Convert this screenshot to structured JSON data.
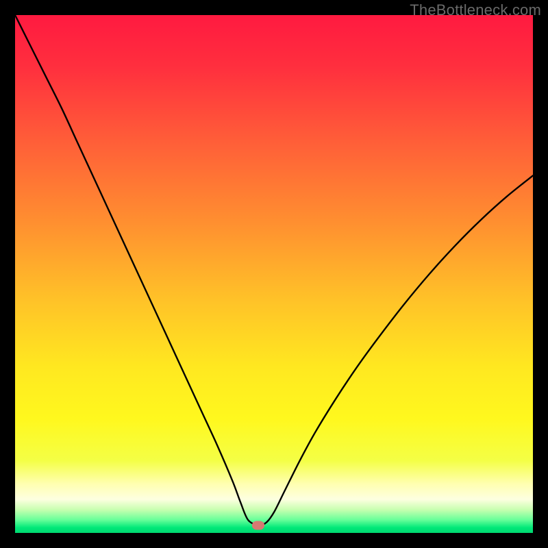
{
  "watermark": {
    "text": "TheBottleneck.com"
  },
  "gradient": {
    "stops": [
      {
        "offset": 0.0,
        "color": "#ff1a40"
      },
      {
        "offset": 0.1,
        "color": "#ff2f3e"
      },
      {
        "offset": 0.25,
        "color": "#ff6038"
      },
      {
        "offset": 0.4,
        "color": "#ff8f30"
      },
      {
        "offset": 0.55,
        "color": "#ffc228"
      },
      {
        "offset": 0.68,
        "color": "#ffe820"
      },
      {
        "offset": 0.78,
        "color": "#fff81e"
      },
      {
        "offset": 0.86,
        "color": "#f4ff45"
      },
      {
        "offset": 0.905,
        "color": "#ffffb0"
      },
      {
        "offset": 0.935,
        "color": "#fdffe0"
      },
      {
        "offset": 0.955,
        "color": "#c8ffb0"
      },
      {
        "offset": 0.975,
        "color": "#66ff99"
      },
      {
        "offset": 0.99,
        "color": "#00e878"
      },
      {
        "offset": 1.0,
        "color": "#00d870"
      }
    ]
  },
  "marker": {
    "x_frac": 0.4695,
    "y_frac": 0.985,
    "color": "#d57a72"
  },
  "chart_data": {
    "type": "line",
    "title": "",
    "xlabel": "",
    "ylabel": "",
    "xlim": [
      0,
      100
    ],
    "ylim": [
      0,
      100
    ],
    "x": [
      0,
      3,
      6,
      9,
      12,
      15,
      18,
      21,
      24,
      27,
      30,
      33,
      36,
      39,
      42,
      43.5,
      45,
      47,
      48.5,
      50,
      52,
      55,
      58,
      62,
      66,
      70,
      75,
      80,
      85,
      90,
      95,
      100
    ],
    "values": [
      100,
      94,
      88,
      82,
      75.5,
      69,
      62.5,
      56,
      49.5,
      43,
      36.5,
      30,
      23.5,
      17,
      10,
      6,
      2.5,
      1.5,
      2,
      4,
      8,
      14,
      19.5,
      26,
      32,
      37.5,
      44,
      50,
      55.5,
      60.5,
      65,
      69
    ],
    "marker_point": {
      "x": 47,
      "y": 1.5
    },
    "note": "V-shaped bottleneck curve on rainbow gradient; minimum near x≈47. y≈percent mismatch (100=worst, 0=best). Values estimated from pixels."
  }
}
